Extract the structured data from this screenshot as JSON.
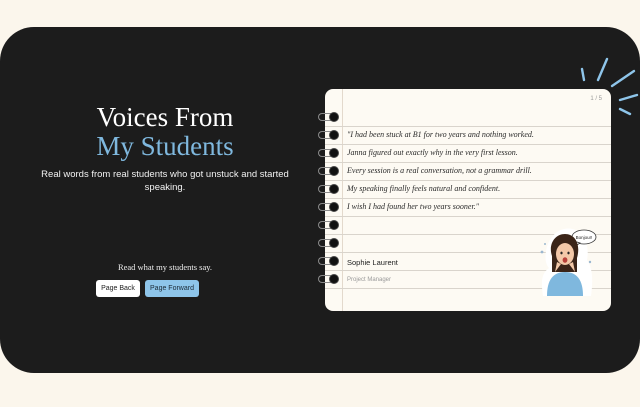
{
  "hero": {
    "title_line1": "Voices From",
    "title_line2": "My Students",
    "subtitle": "Real words from real students who got unstuck and started speaking.",
    "read_label": "Read what my students say."
  },
  "buttons": {
    "back_label": "Page Back",
    "forward_label": "Page Forward"
  },
  "notebook": {
    "page_counter": "1 / 5",
    "lines": [
      "\"I had been stuck at B1 for two years and nothing worked.",
      "Janna figured out exactly why in the very first lesson.",
      "Every session is a real conversation, not a grammar drill.",
      "My speaking finally feels natural and confident.",
      "I wish I had found her two years sooner.\""
    ],
    "author_name": "Sophie Laurent",
    "author_role": "Project Manager",
    "sticker_bubble": "Bonjour!"
  },
  "colors": {
    "page_bg": "#fbf6ec",
    "panel_bg": "#1c1c1c",
    "accent_blue": "#7fb8de",
    "button_blue": "#8ec5ea"
  }
}
